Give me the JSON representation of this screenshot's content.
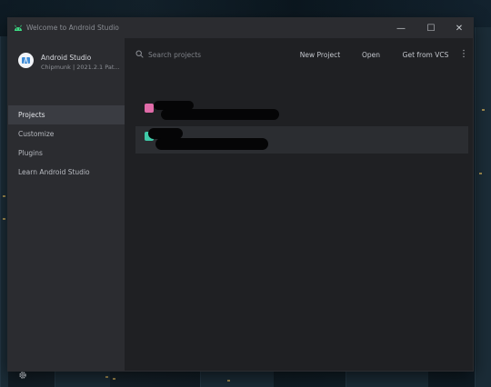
{
  "window": {
    "title": "Welcome to Android Studio",
    "controls": {
      "minimize": "—",
      "maximize": "☐",
      "close": "✕"
    }
  },
  "sidebar": {
    "brand_name": "Android Studio",
    "brand_version": "Chipmunk | 2021.2.1 Pat...",
    "items": [
      {
        "label": "Projects",
        "active": true
      },
      {
        "label": "Customize",
        "active": false
      },
      {
        "label": "Plugins",
        "active": false
      },
      {
        "label": "Learn Android Studio",
        "active": false
      }
    ]
  },
  "toolbar": {
    "search_placeholder": "Search projects",
    "new_project": "New Project",
    "open": "Open",
    "get_from_vcs": "Get from VCS",
    "more": "⋮"
  },
  "projects": [
    {
      "badge": "",
      "badge_color": "#e06ba8",
      "redacted": true
    },
    {
      "badge": "",
      "badge_color": "#3fc9a8",
      "redacted": true
    }
  ],
  "colors": {
    "accent_active": "#3a3c42",
    "sidebar_bg": "#2b2c30",
    "main_bg": "#1f2023"
  }
}
